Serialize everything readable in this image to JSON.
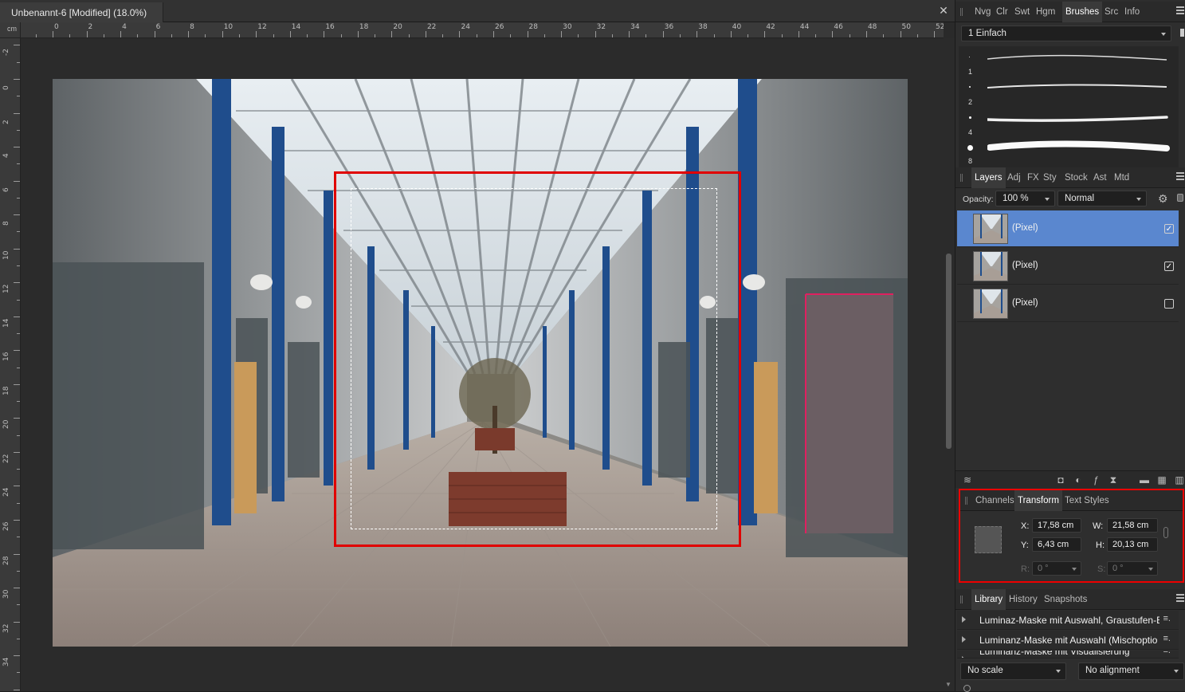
{
  "document": {
    "tab_title": "Unbenannt-6 [Modified] (18.0%)",
    "close_glyph": "✕",
    "ruler_unit": "cm",
    "hruler_labels": [
      "0",
      "2",
      "4",
      "6",
      "8",
      "10",
      "12",
      "14",
      "16",
      "18",
      "20",
      "22",
      "24",
      "26",
      "28",
      "30",
      "32",
      "34",
      "36",
      "38",
      "40",
      "42",
      "44",
      "46",
      "48",
      "50",
      "52"
    ],
    "vruler_labels": [
      "-2",
      "0",
      "2",
      "4",
      "6",
      "8",
      "10",
      "12",
      "14",
      "16",
      "18",
      "20",
      "22",
      "24",
      "26",
      "28",
      "30",
      "32",
      "34"
    ]
  },
  "studio_top": {
    "tabs": [
      "Nvg",
      "Clr",
      "Swt",
      "Hgm",
      "Brushes",
      "Src",
      "Info"
    ],
    "active_tab": "Brushes",
    "category": "1 Einfach",
    "brushes": [
      {
        "size_label": "1"
      },
      {
        "size_label": "2"
      },
      {
        "size_label": "4"
      },
      {
        "size_label": "8"
      }
    ]
  },
  "studio_layers": {
    "tabs": [
      "Layers",
      "Adj",
      "FX",
      "Sty",
      "Stock",
      "Ast",
      "Mtd"
    ],
    "active_tab": "Layers",
    "opacity_label": "Opacity:",
    "opacity_value": "100 %",
    "blend_mode": "Normal",
    "layers": [
      {
        "name": "(Pixel)",
        "visible": true,
        "selected": true,
        "check": "✓"
      },
      {
        "name": "(Pixel)",
        "visible": true,
        "selected": false,
        "check": "✓"
      },
      {
        "name": "(Pixel)",
        "visible": false,
        "selected": false,
        "check": ""
      }
    ]
  },
  "studio_transform": {
    "tabs": [
      "Channels",
      "Transform",
      "Text Styles"
    ],
    "active_tab": "Transform",
    "x_label": "X:",
    "x_value": "17,58 cm",
    "y_label": "Y:",
    "y_value": "6,43 cm",
    "w_label": "W:",
    "w_value": "21,58 cm",
    "h_label": "H:",
    "h_value": "20,13 cm",
    "r_label": "R:",
    "r_value": "0 °",
    "s_label": "S:",
    "s_value": "0 °"
  },
  "studio_library": {
    "tabs": [
      "Library",
      "History",
      "Snapshots"
    ],
    "active_tab": "Library",
    "items": [
      "Luminaz-Maske mit Auswahl, Graustufen-E",
      "Luminanz-Maske mit Auswahl (Mischoptio",
      "Luminanz-Maske mit Visualisierung"
    ],
    "more_glyph": "≡.",
    "scale": "No scale",
    "alignment": "No alignment"
  },
  "colors": {
    "accent": "#5a87cf",
    "highlight_box": "#e00000"
  }
}
